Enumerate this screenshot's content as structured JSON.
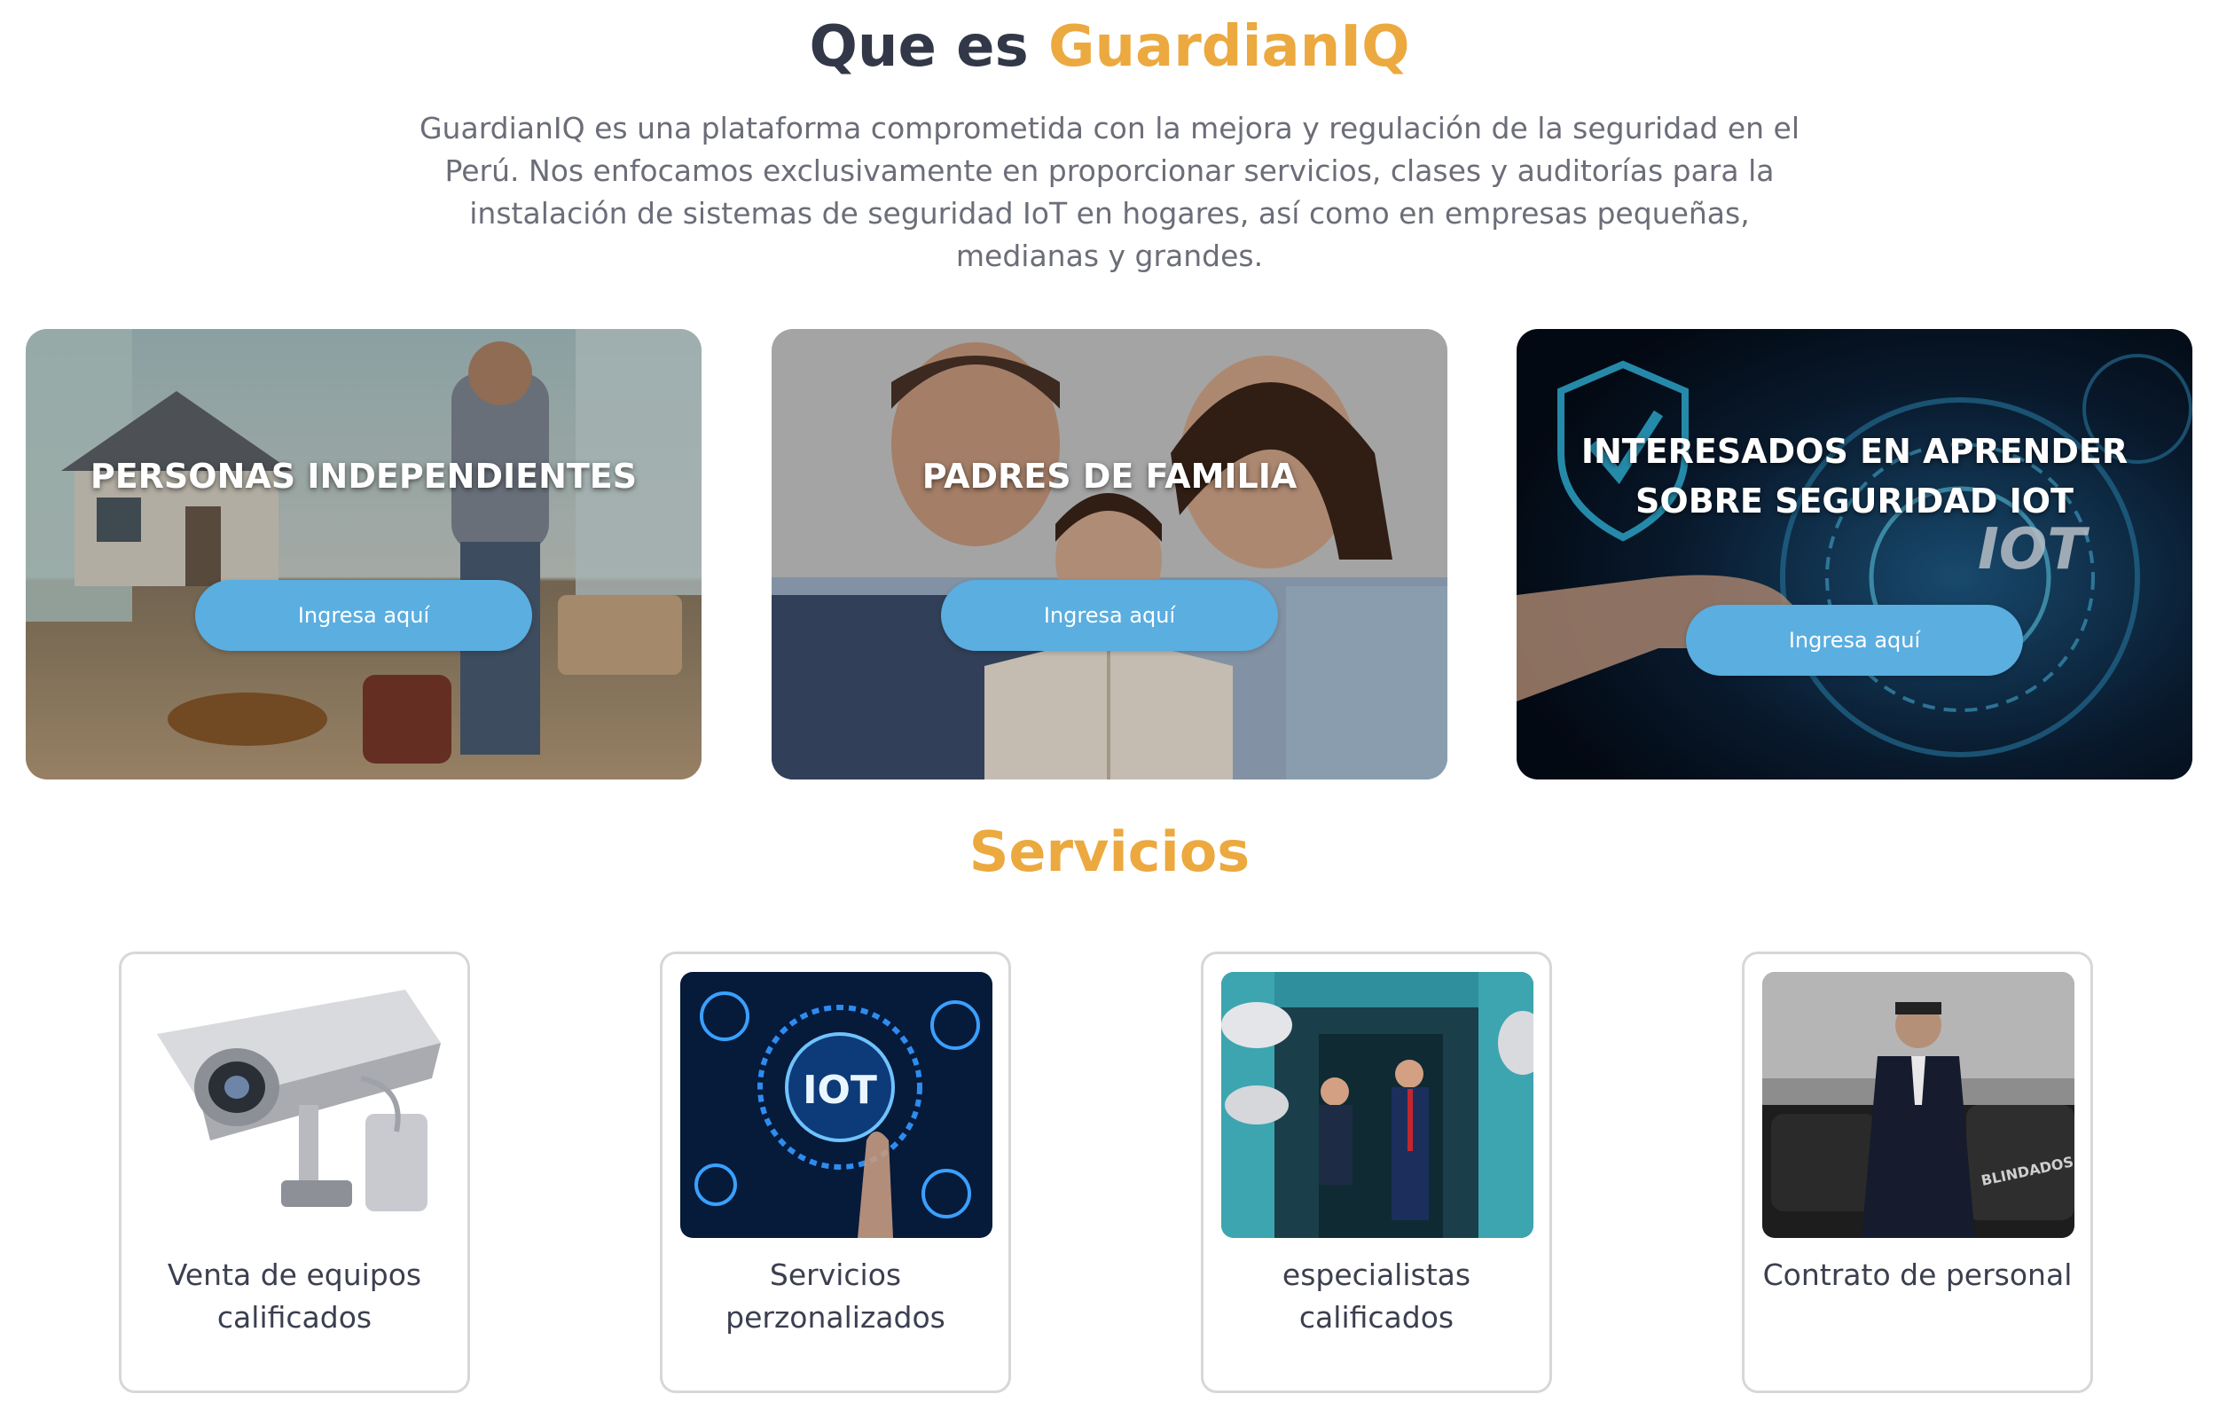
{
  "about": {
    "title_prefix": "Que es",
    "title_brand": "GuardianIQ",
    "description": "GuardianIQ es una plataforma comprometida con la mejora y regulación de la seguridad en el Perú. Nos enfocamos exclusivamente en proporcionar servicios, clases y auditorías para la instalación de sistemas de seguridad IoT en hogares, así como en empresas pequeñas, medianas y grandes."
  },
  "audiences": [
    {
      "title": "PERSONAS INDEPENDIENTES",
      "cta": "Ingresa aquí"
    },
    {
      "title": "PADRES DE FAMILIA",
      "cta": "Ingresa aquí"
    },
    {
      "title": "INTERESADOS EN APRENDER SOBRE SEGURIDAD IOT",
      "cta": "Ingresa aquí"
    }
  ],
  "services": {
    "title": "Servicios",
    "items": [
      {
        "label": "Venta de equipos calificados"
      },
      {
        "label": "Servicios perzonalizados",
        "image_text": "IOT"
      },
      {
        "label": "especialistas calificados"
      },
      {
        "label": "Contrato de personal",
        "image_text": "BLINDADOS"
      }
    ]
  },
  "colors": {
    "accent": "#eca93f",
    "heading": "#323847",
    "button": "#5aaee0",
    "body_text": "#6b6d78"
  }
}
